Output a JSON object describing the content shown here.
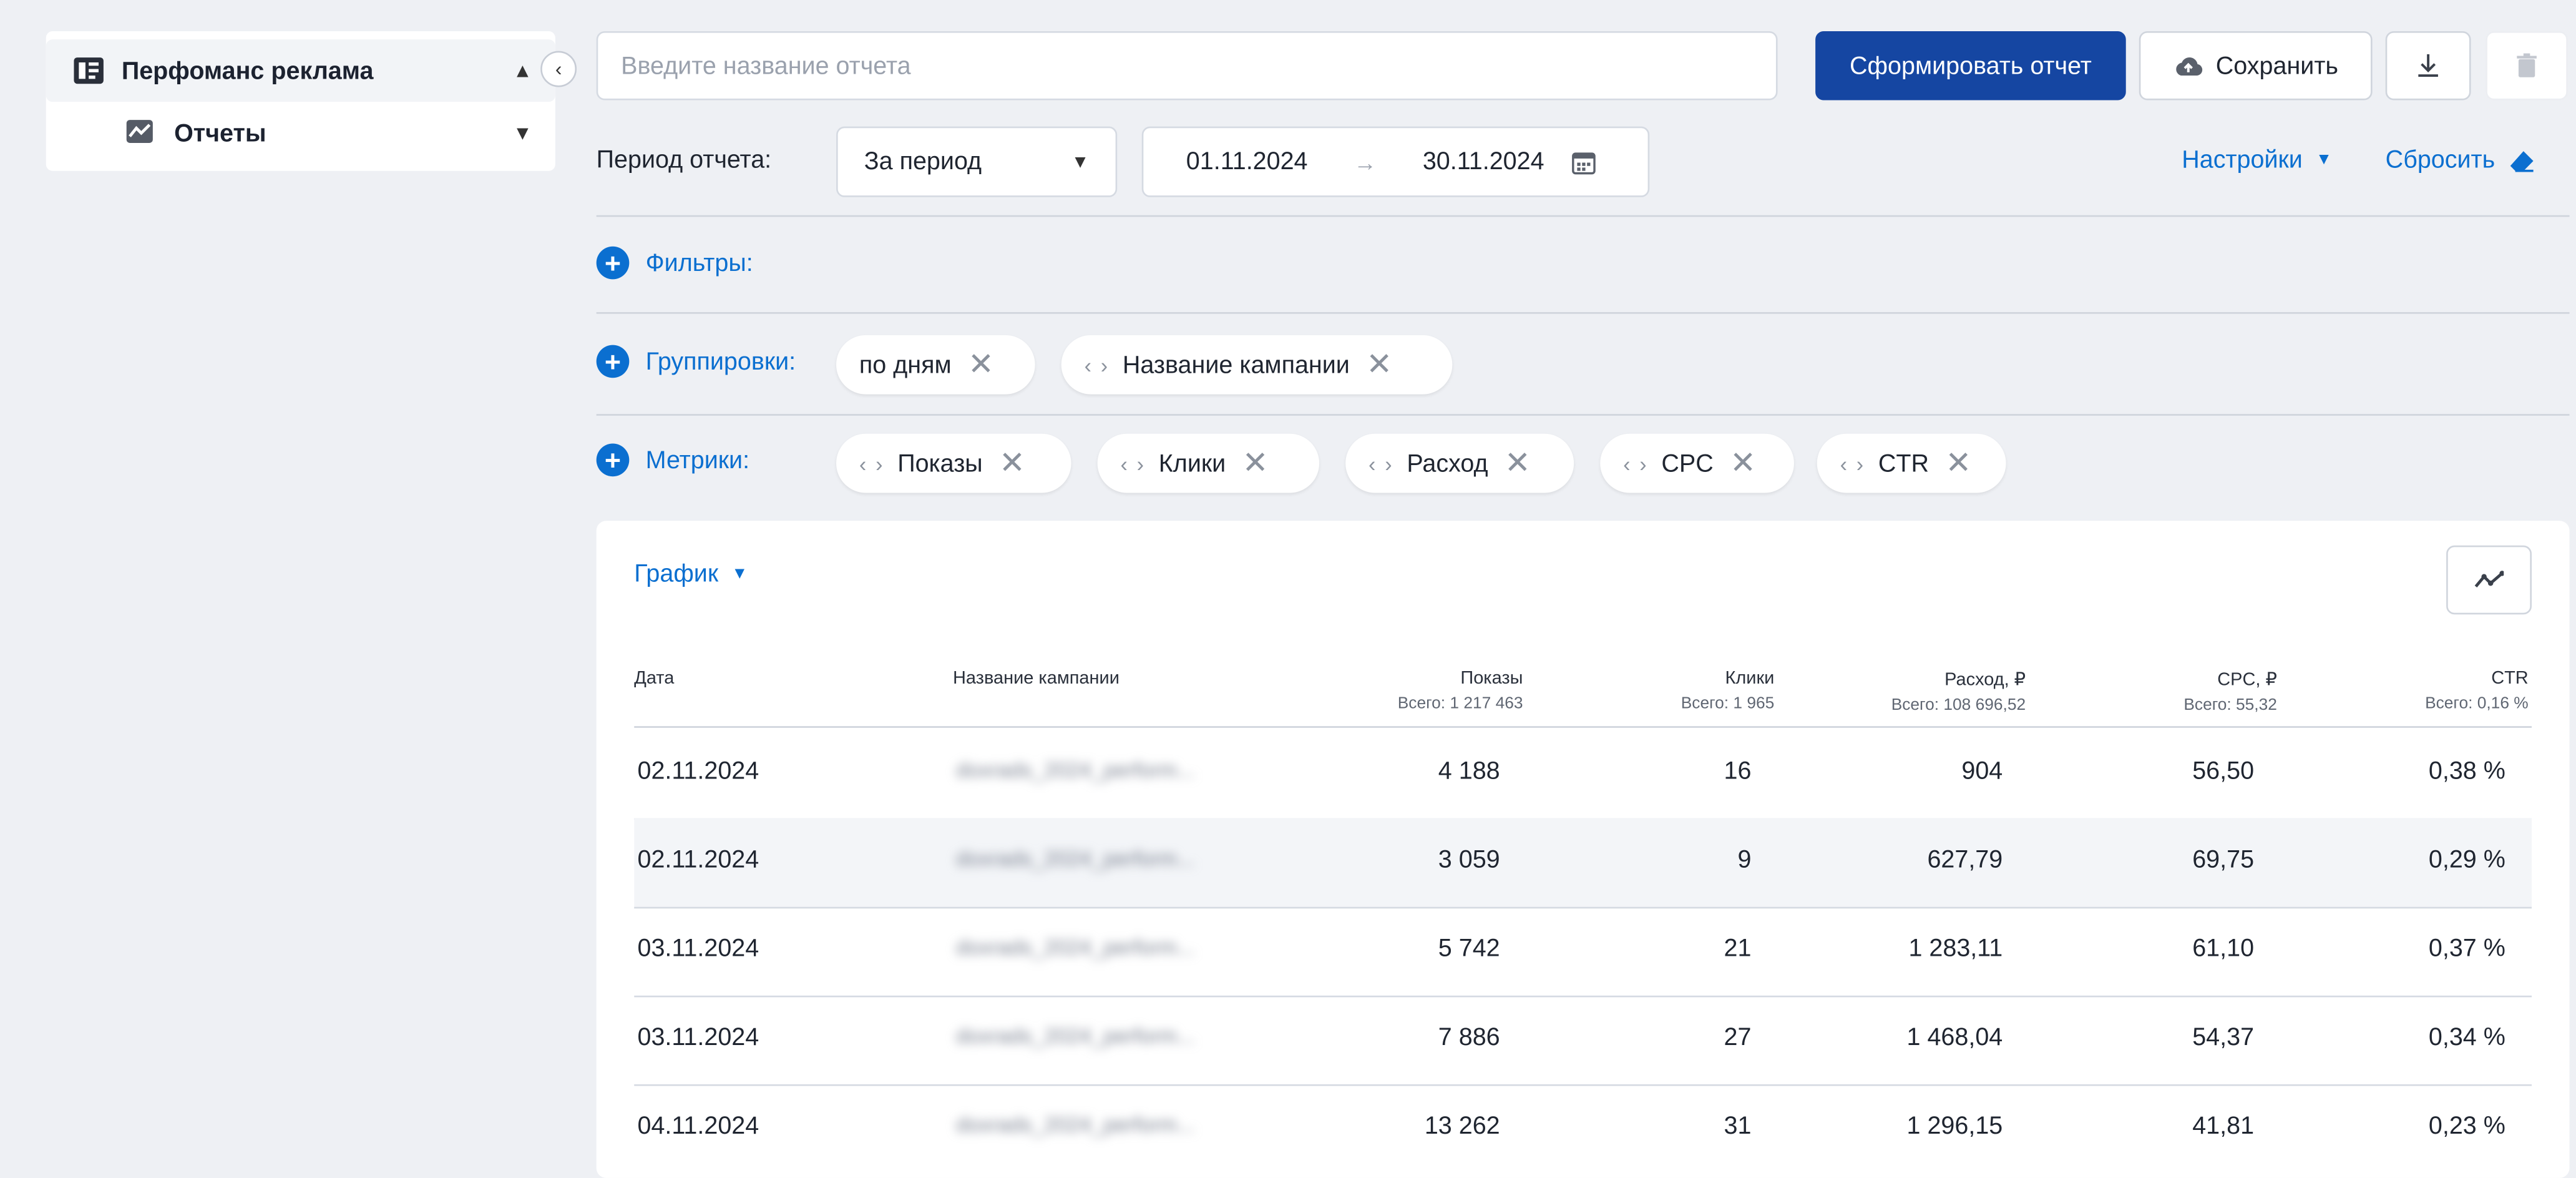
{
  "sidebar": {
    "section_title": "Перфоманс реклама",
    "item_label": "Отчеты"
  },
  "toolbar": {
    "report_name_placeholder": "Введите название отчета",
    "generate_label": "Сформировать отчет",
    "save_label": "Сохранить"
  },
  "period": {
    "label": "Период отчета:",
    "selected": "За период",
    "date_from": "01.11.2024",
    "date_to": "30.11.2024",
    "settings_label": "Настройки",
    "reset_label": "Сбросить"
  },
  "filters": {
    "label": "Фильтры:"
  },
  "groupings": {
    "label": "Группировки:",
    "chips": [
      "по дням",
      "Название кампании"
    ]
  },
  "metrics": {
    "label": "Метрики:",
    "chips": [
      "Показы",
      "Клики",
      "Расход",
      "CPC",
      "CTR"
    ]
  },
  "report": {
    "view_label": "График",
    "columns": [
      {
        "label": "Дата",
        "total": ""
      },
      {
        "label": "Название кампании",
        "total": ""
      },
      {
        "label": "Показы",
        "total": "Всего: 1 217 463"
      },
      {
        "label": "Клики",
        "total": "Всего: 1 965"
      },
      {
        "label": "Расход, ₽",
        "total": "Всего: 108 696,52"
      },
      {
        "label": "CPC, ₽",
        "total": "Всего: 55,32"
      },
      {
        "label": "CTR",
        "total": "Всего: 0,16 %"
      }
    ],
    "rows": [
      {
        "date": "02.11.2024",
        "campaign": "doxrads_2024_perform...",
        "impressions": "4 188",
        "clicks": "16",
        "spend": "904",
        "cpc": "56,50",
        "ctr": "0,38 %"
      },
      {
        "date": "02.11.2024",
        "campaign": "doxrads_2024_perform...",
        "impressions": "3 059",
        "clicks": "9",
        "spend": "627,79",
        "cpc": "69,75",
        "ctr": "0,29 %"
      },
      {
        "date": "03.11.2024",
        "campaign": "doxrads_2024_perform...",
        "impressions": "5 742",
        "clicks": "21",
        "spend": "1 283,11",
        "cpc": "61,10",
        "ctr": "0,37 %"
      },
      {
        "date": "03.11.2024",
        "campaign": "doxrads_2024_perform...",
        "impressions": "7 886",
        "clicks": "27",
        "spend": "1 468,04",
        "cpc": "54,37",
        "ctr": "0,34 %"
      },
      {
        "date": "04.11.2024",
        "campaign": "doxrads_2024_perform...",
        "impressions": "13 262",
        "clicks": "31",
        "spend": "1 296,15",
        "cpc": "41,81",
        "ctr": "0,23 %"
      }
    ]
  },
  "icons": [
    "report-app-icon",
    "chart-icon",
    "chevron-up-icon",
    "chevron-down-icon",
    "collapse-left-icon",
    "cloud-upload-icon",
    "download-icon",
    "trash-icon",
    "calendar-icon",
    "arrow-right-icon",
    "eraser-icon",
    "plus-circle-icon",
    "drag-handle-icon",
    "close-icon",
    "line-chart-icon"
  ],
  "colors": {
    "accent": "#0b6fd0",
    "primary_button": "#1546a2",
    "background": "#eef0f4"
  }
}
